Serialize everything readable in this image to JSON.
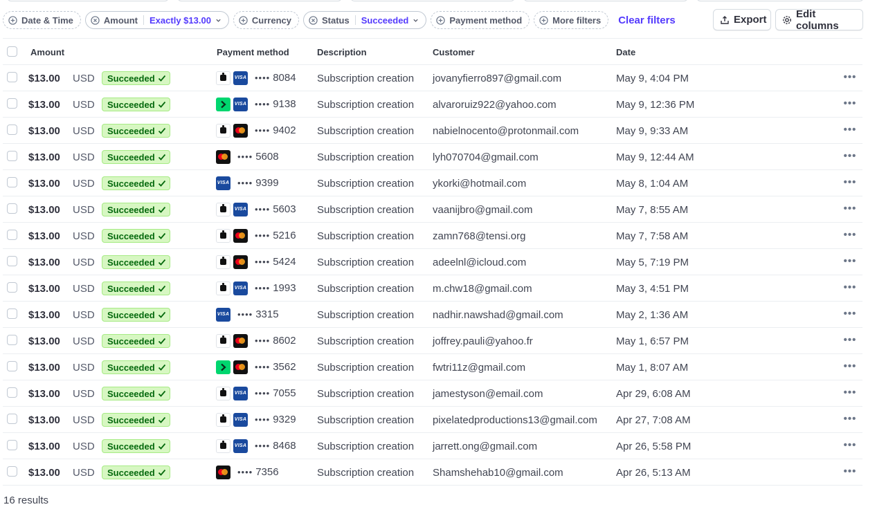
{
  "filters": {
    "date_time": "Date & Time",
    "amount": "Amount",
    "amount_value": "Exactly $13.00",
    "currency": "Currency",
    "status": "Status",
    "status_value": "Succeeded",
    "payment_method": "Payment method",
    "more_filters": "More filters",
    "clear_filters": "Clear filters"
  },
  "toolbar": {
    "export_label": "Export",
    "edit_columns_label": "Edit columns"
  },
  "table": {
    "headers": {
      "amount": "Amount",
      "payment_method": "Payment method",
      "description": "Description",
      "customer": "Customer",
      "date": "Date"
    },
    "rows": [
      {
        "amount": "$13.00",
        "currency": "USD",
        "status": "Succeeded",
        "wallet": "apple",
        "brand": "visa",
        "last4": "8084",
        "description": "Subscription creation",
        "customer": "jovanyfierro897@gmail.com",
        "date": "May 9, 4:04 PM"
      },
      {
        "amount": "$13.00",
        "currency": "USD",
        "status": "Succeeded",
        "wallet": "link",
        "brand": "visa",
        "last4": "9138",
        "description": "Subscription creation",
        "customer": "alvaroruiz922@yahoo.com",
        "date": "May 9, 12:36 PM"
      },
      {
        "amount": "$13.00",
        "currency": "USD",
        "status": "Succeeded",
        "wallet": "apple",
        "brand": "mastercard",
        "last4": "9402",
        "description": "Subscription creation",
        "customer": "nabielnocento@protonmail.com",
        "date": "May 9, 9:33 AM"
      },
      {
        "amount": "$13.00",
        "currency": "USD",
        "status": "Succeeded",
        "wallet": "",
        "brand": "mastercard",
        "last4": "5608",
        "description": "Subscription creation",
        "customer": "lyh070704@gmail.com",
        "date": "May 9, 12:44 AM"
      },
      {
        "amount": "$13.00",
        "currency": "USD",
        "status": "Succeeded",
        "wallet": "",
        "brand": "visa",
        "last4": "9399",
        "description": "Subscription creation",
        "customer": "ykorki@hotmail.com",
        "date": "May 8, 1:04 AM"
      },
      {
        "amount": "$13.00",
        "currency": "USD",
        "status": "Succeeded",
        "wallet": "apple",
        "brand": "visa",
        "last4": "5603",
        "description": "Subscription creation",
        "customer": "vaanijbro@gmail.com",
        "date": "May 7, 8:55 AM"
      },
      {
        "amount": "$13.00",
        "currency": "USD",
        "status": "Succeeded",
        "wallet": "apple",
        "brand": "mastercard",
        "last4": "5216",
        "description": "Subscription creation",
        "customer": "zamn768@tensi.org",
        "date": "May 7, 7:58 AM"
      },
      {
        "amount": "$13.00",
        "currency": "USD",
        "status": "Succeeded",
        "wallet": "apple",
        "brand": "mastercard",
        "last4": "5424",
        "description": "Subscription creation",
        "customer": "adeelnl@icloud.com",
        "date": "May 5, 7:19 PM"
      },
      {
        "amount": "$13.00",
        "currency": "USD",
        "status": "Succeeded",
        "wallet": "apple",
        "brand": "visa",
        "last4": "1993",
        "description": "Subscription creation",
        "customer": "m.chw18@gmail.com",
        "date": "May 3, 4:51 PM"
      },
      {
        "amount": "$13.00",
        "currency": "USD",
        "status": "Succeeded",
        "wallet": "",
        "brand": "visa",
        "last4": "3315",
        "description": "Subscription creation",
        "customer": "nadhir.nawshad@gmail.com",
        "date": "May 2, 1:36 AM"
      },
      {
        "amount": "$13.00",
        "currency": "USD",
        "status": "Succeeded",
        "wallet": "apple",
        "brand": "mastercard",
        "last4": "8602",
        "description": "Subscription creation",
        "customer": "joffrey.pauli@yahoo.fr",
        "date": "May 1, 6:57 PM"
      },
      {
        "amount": "$13.00",
        "currency": "USD",
        "status": "Succeeded",
        "wallet": "link",
        "brand": "mastercard",
        "last4": "3562",
        "description": "Subscription creation",
        "customer": "fwtri11z@gmail.com",
        "date": "May 1, 8:07 AM"
      },
      {
        "amount": "$13.00",
        "currency": "USD",
        "status": "Succeeded",
        "wallet": "apple",
        "brand": "visa",
        "last4": "7055",
        "description": "Subscription creation",
        "customer": "jamestyson@email.com",
        "date": "Apr 29, 6:08 AM"
      },
      {
        "amount": "$13.00",
        "currency": "USD",
        "status": "Succeeded",
        "wallet": "apple",
        "brand": "visa",
        "last4": "9329",
        "description": "Subscription creation",
        "customer": "pixelatedproductions13@gmail.com",
        "date": "Apr 27, 7:08 AM"
      },
      {
        "amount": "$13.00",
        "currency": "USD",
        "status": "Succeeded",
        "wallet": "apple",
        "brand": "visa",
        "last4": "8468",
        "description": "Subscription creation",
        "customer": "jarrett.ong@gmail.com",
        "date": "Apr 26, 5:58 PM"
      },
      {
        "amount": "$13.00",
        "currency": "USD",
        "status": "Succeeded",
        "wallet": "",
        "brand": "mastercard",
        "last4": "7356",
        "description": "Subscription creation",
        "customer": "Shamshehab10@gmail.com",
        "date": "Apr 26, 5:13 AM"
      }
    ]
  },
  "icons": {
    "masked_digits": "••••",
    "visa_mark": "VISA",
    "more_glyph": "•••"
  },
  "footer": {
    "results": "16 results"
  },
  "colors": {
    "accent": "#533afd",
    "success_bg": "#d7f7c2",
    "success_text": "#05690d",
    "link_green": "#00d66f",
    "visa_blue": "#1a4a9e"
  }
}
